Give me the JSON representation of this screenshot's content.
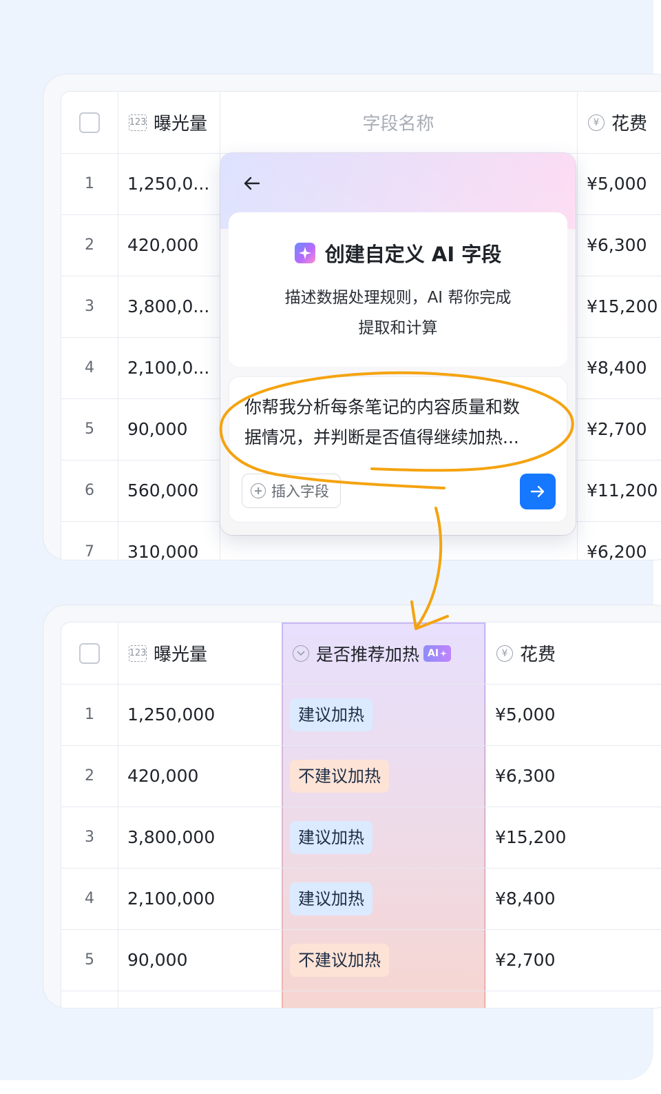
{
  "top_table": {
    "headers": {
      "exposure": "曝光量",
      "placeholder": "字段名称",
      "cost": "花费"
    },
    "rows": [
      {
        "num": "1",
        "exposure": "1,250,0...",
        "cost": "¥5,000"
      },
      {
        "num": "2",
        "exposure": "420,000",
        "cost": "¥6,300"
      },
      {
        "num": "3",
        "exposure": "3,800,0...",
        "cost": "¥15,200"
      },
      {
        "num": "4",
        "exposure": "2,100,0...",
        "cost": "¥8,400"
      },
      {
        "num": "5",
        "exposure": "90,000",
        "cost": "¥2,700"
      },
      {
        "num": "6",
        "exposure": "560,000",
        "cost": "¥11,200"
      },
      {
        "num": "7",
        "exposure": "310,000",
        "cost": "¥6,200"
      }
    ]
  },
  "popup": {
    "title": "创建自定义 AI 字段",
    "desc_line1": "描述数据处理规则，AI 帮你完成",
    "desc_line2": "提取和计算",
    "prompt_line1": "你帮我分析每条笔记的内容质量和数",
    "prompt_line2": "据情况，并判断是否值得继续加热...",
    "insert_label": "插入字段"
  },
  "bottom_table": {
    "headers": {
      "exposure": "曝光量",
      "ai_field": "是否推荐加热",
      "ai_badge": "AI",
      "cost": "花费"
    },
    "rows": [
      {
        "num": "1",
        "exposure": "1,250,000",
        "tag": "建议加热",
        "tag_type": "yes",
        "cost": "¥5,000"
      },
      {
        "num": "2",
        "exposure": "420,000",
        "tag": "不建议加热",
        "tag_type": "no",
        "cost": "¥6,300"
      },
      {
        "num": "3",
        "exposure": "3,800,000",
        "tag": "建议加热",
        "tag_type": "yes",
        "cost": "¥15,200"
      },
      {
        "num": "4",
        "exposure": "2,100,000",
        "tag": "建议加热",
        "tag_type": "yes",
        "cost": "¥8,400"
      },
      {
        "num": "5",
        "exposure": "90,000",
        "tag": "不建议加热",
        "tag_type": "no",
        "cost": "¥2,700"
      }
    ]
  },
  "icons": {
    "number_field": "number-type-icon",
    "currency_field": "yen-icon",
    "single_select": "chevron-down-circle-icon",
    "back": "arrow-left-icon",
    "send": "arrow-right-icon",
    "sparkle": "sparkle-icon",
    "insert": "plus-circle-icon"
  },
  "colors": {
    "accent": "#1677ff",
    "annotation": "#f4a310",
    "tag_yes_bg": "#dbeafe",
    "tag_no_bg": "#fde3d6"
  }
}
